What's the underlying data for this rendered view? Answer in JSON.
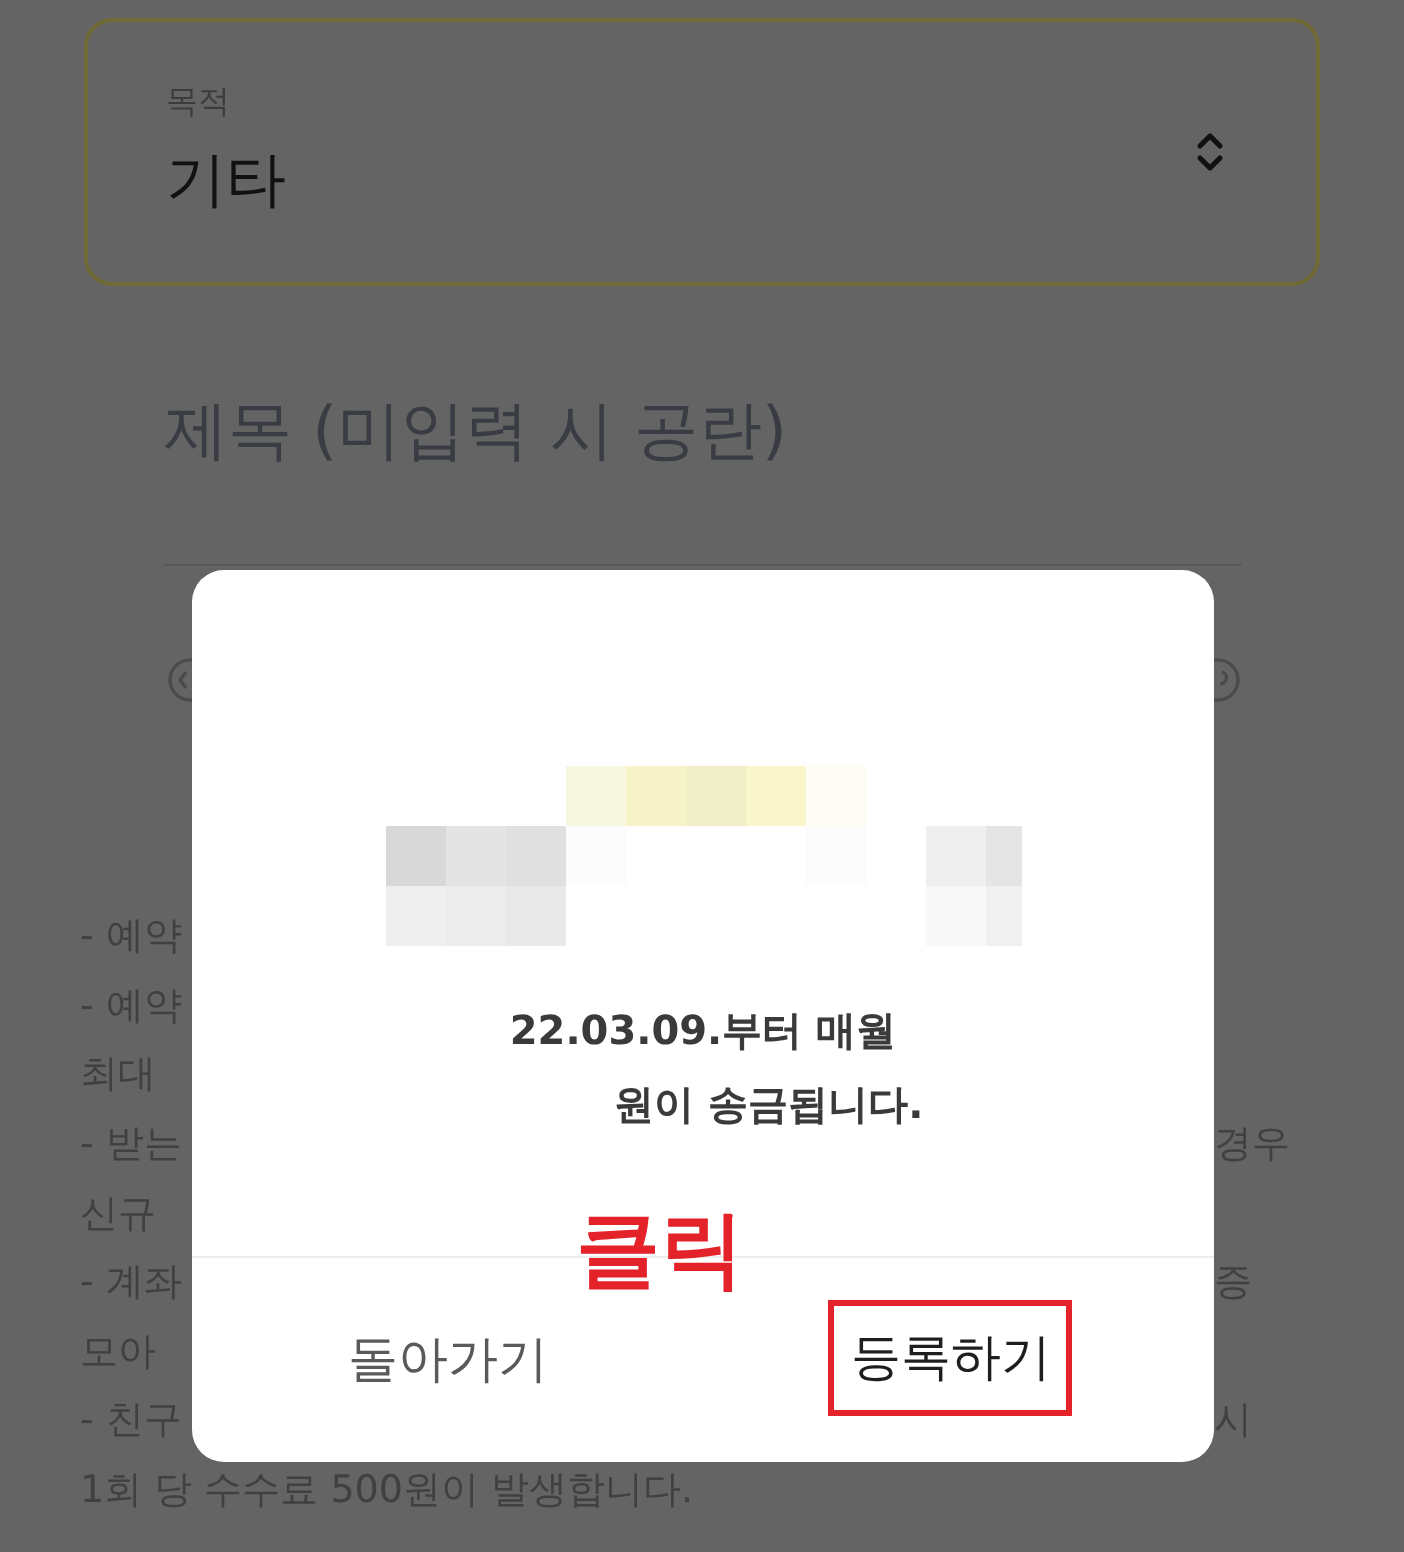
{
  "purpose_select": {
    "label": "목적",
    "value": "기타"
  },
  "title_field": {
    "placeholder": "제목 (미입력 시 공란)"
  },
  "notes": [
    {
      "kind": "covered",
      "left": "- 예약"
    },
    {
      "kind": "covered",
      "left": "- 예약"
    },
    {
      "kind": "covered",
      "left": "최대"
    },
    {
      "kind": "covered",
      "left": "- 받는",
      "right": "경우"
    },
    {
      "kind": "covered",
      "left": "신규"
    },
    {
      "kind": "covered",
      "left": "- 계좌",
      "right": "증"
    },
    {
      "kind": "covered",
      "left": "모아"
    },
    {
      "kind": "covered",
      "left": "- 친구",
      "right": "시"
    },
    {
      "kind": "full",
      "text": "1회 당 수수료 500원이 발생합니다."
    }
  ],
  "dialog": {
    "message": [
      {
        "kind": "date",
        "text": "22.03.09.부터 매월"
      },
      {
        "kind": "amount",
        "text": "원이 송금됩니다."
      }
    ],
    "buttons": [
      {
        "kind": "cancel",
        "label": "돌아가기",
        "highlighted": false
      },
      {
        "kind": "confirm",
        "label": "등록하기",
        "highlighted": true
      }
    ]
  },
  "annotation": {
    "text": "클릭"
  }
}
